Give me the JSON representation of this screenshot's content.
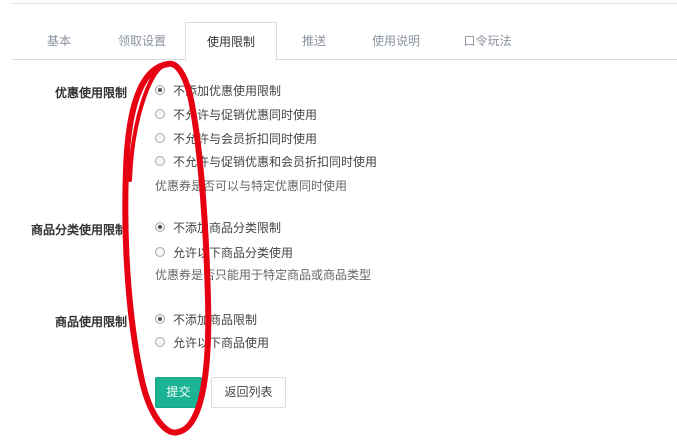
{
  "tabs": [
    {
      "label": "基本"
    },
    {
      "label": "领取设置"
    },
    {
      "label": "使用限制",
      "active": true
    },
    {
      "label": "推送"
    },
    {
      "label": "使用说明"
    },
    {
      "label": "口令玩法"
    }
  ],
  "sections": {
    "promo": {
      "label": "优惠使用限制",
      "options": [
        {
          "label": "不添加优惠使用限制",
          "checked": true
        },
        {
          "label": "不允许与促销优惠同时使用",
          "checked": false
        },
        {
          "label": "不允许与会员折扣同时使用",
          "checked": false
        },
        {
          "label": "不允许与促销优惠和会员折扣同时使用",
          "checked": false
        }
      ],
      "hint": "优惠券是否可以与特定优惠同时使用"
    },
    "category": {
      "label": "商品分类使用限制",
      "options": [
        {
          "label": "不添加商品分类限制",
          "checked": true
        },
        {
          "label": "允许以下商品分类使用",
          "checked": false
        }
      ],
      "hint": "优惠券是否只能用于特定商品或商品类型"
    },
    "product": {
      "label": "商品使用限制",
      "options": [
        {
          "label": "不添加商品限制",
          "checked": true
        },
        {
          "label": "允许以下商品使用",
          "checked": false
        }
      ]
    }
  },
  "buttons": {
    "submit": "提交",
    "back": "返回列表"
  },
  "annotation": {
    "color": "#e60012"
  }
}
